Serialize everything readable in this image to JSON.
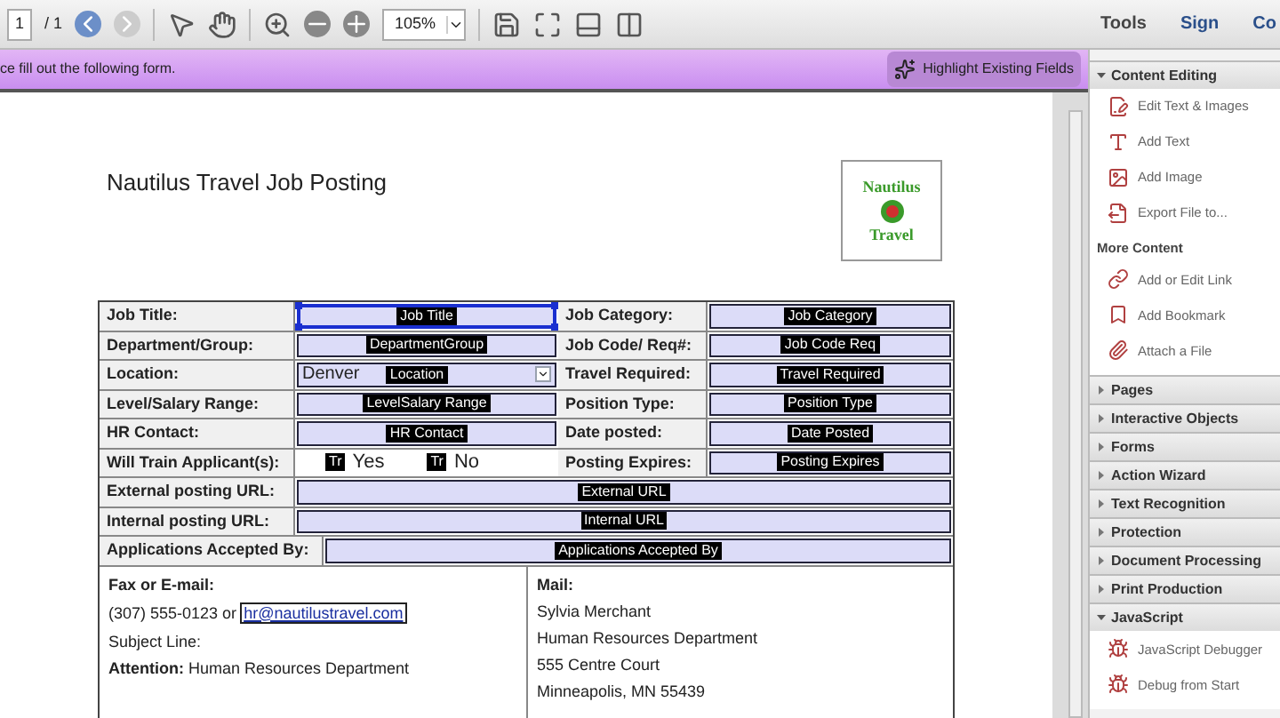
{
  "toolbar": {
    "page": "1",
    "page_total": "/ 1",
    "zoom": "105%",
    "tabs": [
      {
        "label": "Tools",
        "selected": false
      },
      {
        "label": "Sign",
        "selected": false
      },
      {
        "label": "Co",
        "selected": false
      }
    ]
  },
  "message_bar": {
    "text": "ce fill out the following form.",
    "button": "Highlight Existing Fields"
  },
  "document": {
    "title": "Nautilus Travel Job Posting",
    "logo": {
      "top": "Nautilus",
      "bottom": "Travel"
    },
    "rows": [
      {
        "cells": [
          {
            "label": "Job Title:",
            "field": {
              "kind": "text",
              "tag": "Job Title",
              "selected": true
            }
          },
          {
            "label": "Job Category:",
            "field": {
              "kind": "text",
              "tag": "Job Category",
              "selected": false
            }
          }
        ]
      },
      {
        "cells": [
          {
            "label": "Department/Group:",
            "field": {
              "kind": "text",
              "tag": "DepartmentGroup",
              "selected": false
            }
          },
          {
            "label": "Job Code/ Req#:",
            "field": {
              "kind": "text",
              "tag": "Job Code Req",
              "selected": false
            }
          }
        ]
      },
      {
        "cells": [
          {
            "label": "Location:",
            "field": {
              "kind": "dropdown",
              "value": "Denver",
              "tag": "Location",
              "selected": false
            }
          },
          {
            "label": "Travel Required:",
            "field": {
              "kind": "text",
              "tag": "Travel Required",
              "selected": false
            }
          }
        ]
      },
      {
        "cells": [
          {
            "label": "Level/Salary Range:",
            "field": {
              "kind": "text",
              "tag": "LevelSalary Range",
              "selected": false
            }
          },
          {
            "label": "Position Type:",
            "field": {
              "kind": "text",
              "tag": "Position Type",
              "selected": false
            }
          }
        ]
      },
      {
        "cells": [
          {
            "label": "HR Contact:",
            "field": {
              "kind": "text",
              "tag": "HR Contact",
              "selected": false
            }
          },
          {
            "label": "Date posted:",
            "field": {
              "kind": "text",
              "tag": "Date Posted",
              "selected": false
            }
          }
        ]
      },
      {
        "cells": [
          {
            "label": "Will Train Applicant(s):",
            "field": {
              "kind": "checkboxes",
              "options": [
                {
                  "tag": "Tr",
                  "label": "Yes"
                },
                {
                  "tag": "Tr",
                  "label": "No"
                }
              ]
            }
          },
          {
            "label": "Posting Expires:",
            "field": {
              "kind": "text",
              "tag": "Posting Expires",
              "selected": false
            }
          }
        ]
      },
      {
        "cells": [
          {
            "label": "External posting URL:",
            "field": {
              "kind": "text",
              "tag": "External URL",
              "selected": false
            }
          }
        ]
      },
      {
        "cells": [
          {
            "label": "Internal posting URL:",
            "field": {
              "kind": "text",
              "tag": "Internal URL",
              "selected": false
            }
          }
        ]
      },
      {
        "cells": [
          {
            "label": "Applications Accepted By:",
            "field": {
              "kind": "text",
              "tag": "Applications Accepted By",
              "selected": false
            }
          }
        ]
      }
    ],
    "contact": {
      "left": {
        "heading": "Fax or E-mail:",
        "phone": "(307) 555-0123 or",
        "email": "hr@nautilustravel.com",
        "lines": [
          "Subject Line:",
          "**Attention:** Human Resources Department"
        ]
      },
      "right": {
        "heading": "Mail:",
        "lines": [
          "Sylvia Merchant",
          "Human Resources Department",
          "555 Centre Court",
          "Minneapolis, MN 55439"
        ]
      }
    }
  },
  "panel": {
    "sections": [
      {
        "title": "Content Editing",
        "expanded": true,
        "groups": [
          {
            "items": [
              {
                "label": "Edit Text & Images"
              },
              {
                "label": "Add Text"
              },
              {
                "label": "Add Image"
              },
              {
                "label": "Export File to..."
              }
            ]
          },
          {
            "heading": "More Content",
            "items": [
              {
                "label": "Add or Edit Link"
              },
              {
                "label": "Add Bookmark"
              },
              {
                "label": "Attach a File"
              }
            ]
          }
        ]
      },
      {
        "title": "Pages",
        "expanded": false
      },
      {
        "title": "Interactive Objects",
        "expanded": false
      },
      {
        "title": "Forms",
        "expanded": false
      },
      {
        "title": "Action Wizard",
        "expanded": false
      },
      {
        "title": "Text Recognition",
        "expanded": false
      },
      {
        "title": "Protection",
        "expanded": false
      },
      {
        "title": "Document Processing",
        "expanded": false
      },
      {
        "title": "Print Production",
        "expanded": false
      },
      {
        "title": "JavaScript",
        "expanded": true,
        "groups": [
          {
            "items": [
              {
                "label": "JavaScript Debugger"
              },
              {
                "label": "Debug from Start"
              }
            ]
          }
        ]
      }
    ]
  }
}
